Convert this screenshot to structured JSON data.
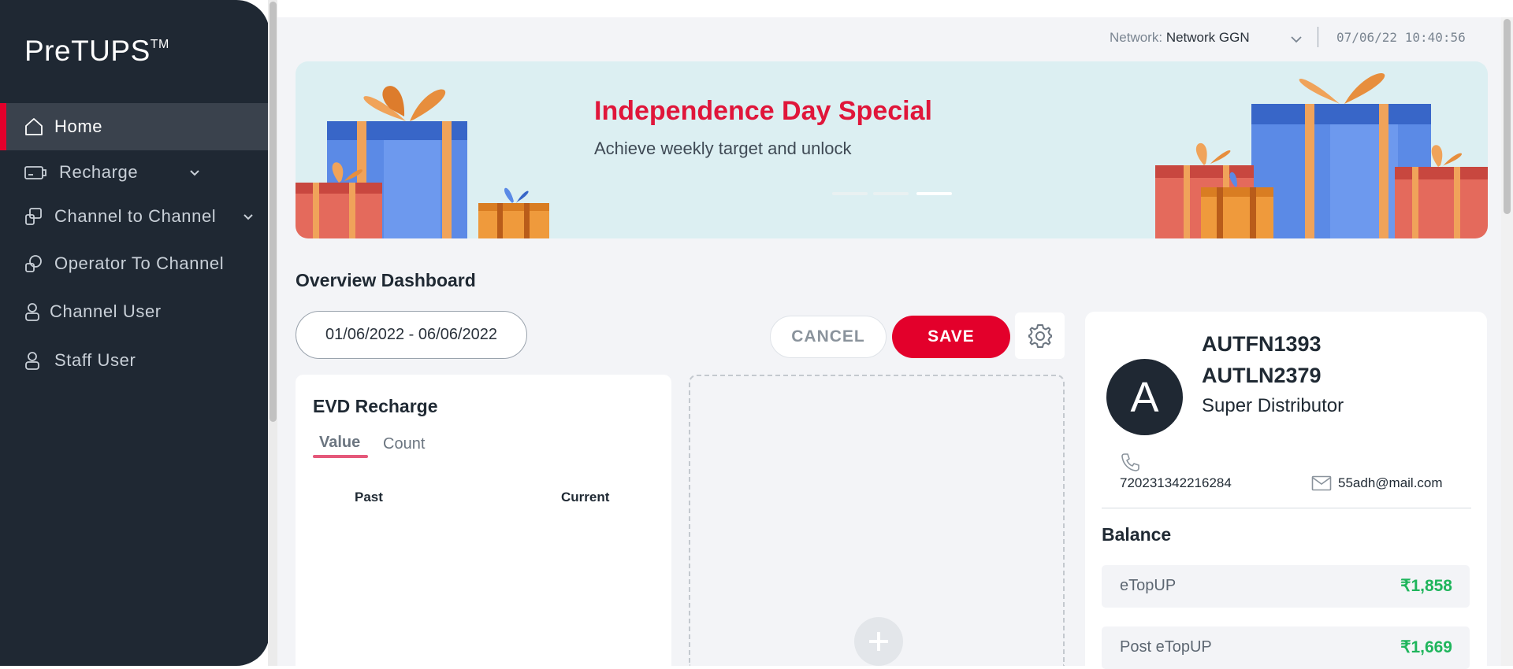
{
  "app": {
    "logo_text": "PreTUPS",
    "logo_tm": "TM"
  },
  "sidebar": {
    "items": [
      {
        "label": "Home",
        "icon": "home-icon",
        "active": true
      },
      {
        "label": "Recharge",
        "icon": "recharge-card-icon",
        "has_submenu": true
      },
      {
        "label": "Channel to Channel",
        "icon": "channel-transfer-icon",
        "has_submenu": true
      },
      {
        "label": "Operator To Channel",
        "icon": "operator-transfer-icon"
      },
      {
        "label": "Channel User",
        "icon": "user-icon"
      },
      {
        "label": "Staff User",
        "icon": "user-icon"
      }
    ]
  },
  "topbar": {
    "network_label": "Network:",
    "network_value": "Network GGN",
    "datetime": "07/06/22 10:40:56"
  },
  "banner": {
    "title": "Independence Day Special",
    "subtitle": "Achieve weekly target and unlock",
    "slides_total": 3,
    "active_slide": 3
  },
  "dashboard": {
    "title": "Overview Dashboard",
    "date_range": "01/06/2022 - 06/06/2022",
    "cancel_label": "CANCEL",
    "save_label": "SAVE"
  },
  "evd_card": {
    "title": "EVD Recharge",
    "tabs": [
      "Value",
      "Count"
    ],
    "active_tab": "Value",
    "columns": [
      "Past",
      "Current"
    ]
  },
  "profile": {
    "avatar_letter": "A",
    "first_name": "AUTFN1393",
    "last_name": "AUTLN2379",
    "role": "Super Distributor",
    "phone": "720231342216284",
    "email": "55adh@mail.com"
  },
  "balance": {
    "title": "Balance",
    "rows": [
      {
        "label": "eTopUP",
        "value": "₹1,858"
      },
      {
        "label": "Post eTopUP",
        "value": "₹1,669"
      }
    ]
  },
  "colors": {
    "accent": "#e3002b",
    "sidebar_bg": "#1f2833",
    "positive": "#1fb55c"
  }
}
